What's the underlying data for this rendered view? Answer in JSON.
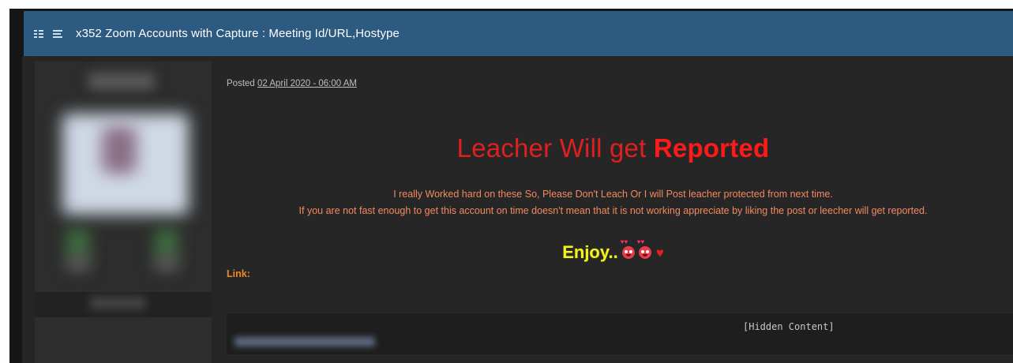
{
  "topic": {
    "title": "x352 Zoom Accounts with Capture : Meeting Id/URL,Hostype"
  },
  "post": {
    "posted_label": "Posted",
    "posted_date": "02 April 2020 - 06:00 AM",
    "headline_regular": "Leacher Will get ",
    "headline_bold": "Reported",
    "message_line_1": "I really Worked hard on these So, Please Don't Leach Or I will Post leacher protected from next time.",
    "message_line_2": "If you are not fast enough to get this account on time doesn't mean that it is not working appreciate by liking the post or leecher will get reported.",
    "enjoy_text": "Enjoy..",
    "link_label": "Link:",
    "hidden_content_text": "[Hidden Content]"
  },
  "colors": {
    "title_bar": "#2d5a81",
    "headline": "#e02020",
    "message": "#f28a60",
    "enjoy": "#f2f220",
    "link_label": "#f08a1e"
  },
  "icons": [
    "list-view-icon",
    "text-view-icon",
    "love-emoji-icon",
    "heart-icon"
  ]
}
